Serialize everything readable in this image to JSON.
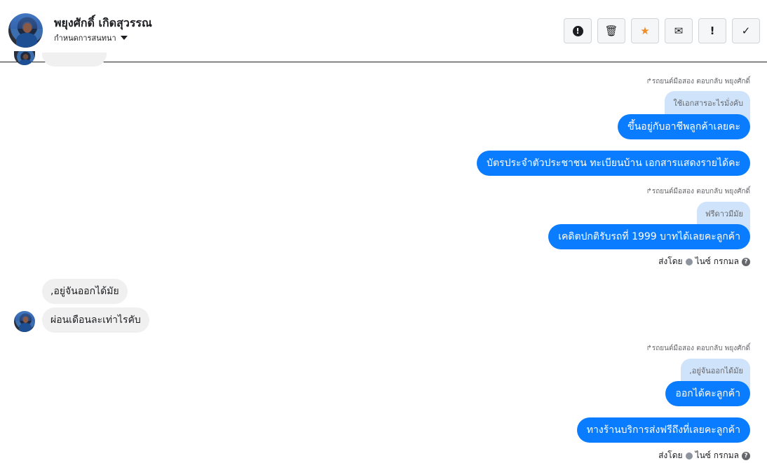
{
  "header": {
    "contact_name": "พยุงศักดิ์ เกิดสุวรรณ",
    "assign_label": "กำหนดการสนทนา",
    "actions": {
      "report": "!",
      "delete": "🗑",
      "star": "★",
      "mail": "✉",
      "flag": "!",
      "done": "✓"
    }
  },
  "messages": {
    "reply_note_1": "รถยนต์มือสอง ตอบกลับ พยุงศักดิ์",
    "quoted_1": "ใช้เอกสารอะไรมั่งคับ",
    "out_1": "ขึ้นอยู่กับอาชีพลูกค้าเลยคะ",
    "out_2": "บัตรประจำตัวประชาชน ทะเบียนบ้าน เอกสารแสดงรายได้คะ",
    "reply_note_2": "รถยนต์มือสอง ตอบกลับ พยุงศักดิ์",
    "quoted_2": "ฟรีดาวมีมัย",
    "out_3": "เคดิตปกติรับรถที่ 1999 บาทได้เลยคะลูกค้า",
    "sent_by_1": "ส่งโดย",
    "sender_1": "ไนซ์ กรกมล",
    "in_1": ",อยู่จันออกได้มัย",
    "in_2": "ผ่อนเดือนละเท่าไรคับ",
    "reply_note_3": "รถยนต์มือสอง ตอบกลับ พยุงศักดิ์",
    "quoted_3": ",อยู่จันออกได้มัย",
    "out_4": "ออกได้คะลูกค้า",
    "out_5": "ทางร้านบริการส่งฟรีถึงที่เลยคะลูกค้า",
    "sent_by_2": "ส่งโดย",
    "sender_2": "ไนซ์ กรกมล"
  },
  "colors": {
    "outgoing": "#0a7cff",
    "incoming": "#f0f0f0",
    "quoted": "#cfe3fb",
    "star": "#f28c28"
  },
  "icons": [
    "alert-circle-icon",
    "trash-icon",
    "star-icon",
    "envelope-icon",
    "exclamation-icon",
    "check-icon",
    "reply-arrow-icon",
    "help-circle-icon",
    "verified-dot-icon",
    "chevron-down-icon"
  ]
}
